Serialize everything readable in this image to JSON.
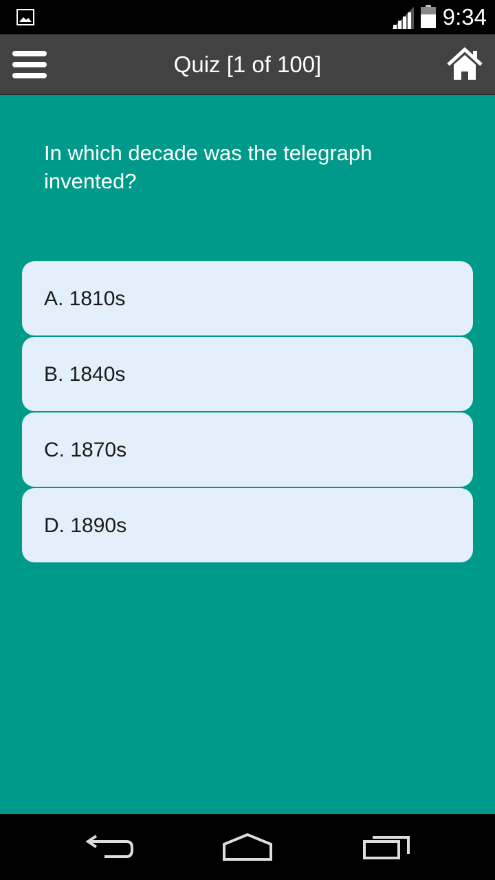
{
  "status_bar": {
    "time": "9:34",
    "icons": [
      "image-notification-icon",
      "signal-icon",
      "battery-icon"
    ]
  },
  "app_bar": {
    "title": "Quiz [1 of 100]",
    "menu_icon": "hamburger-menu-icon",
    "home_icon": "home-icon",
    "background": "#424242"
  },
  "quiz": {
    "question": "In which decade was the telegraph invented?",
    "answers": [
      {
        "label": "A. 1810s"
      },
      {
        "label": "B. 1840s"
      },
      {
        "label": "C. 1870s"
      },
      {
        "label": "D. 1890s"
      }
    ],
    "background": "#009a8a",
    "answer_background": "#e3f0fb"
  },
  "nav_bar": {
    "icons": [
      "back-icon",
      "home-nav-icon",
      "recent-apps-icon"
    ]
  }
}
